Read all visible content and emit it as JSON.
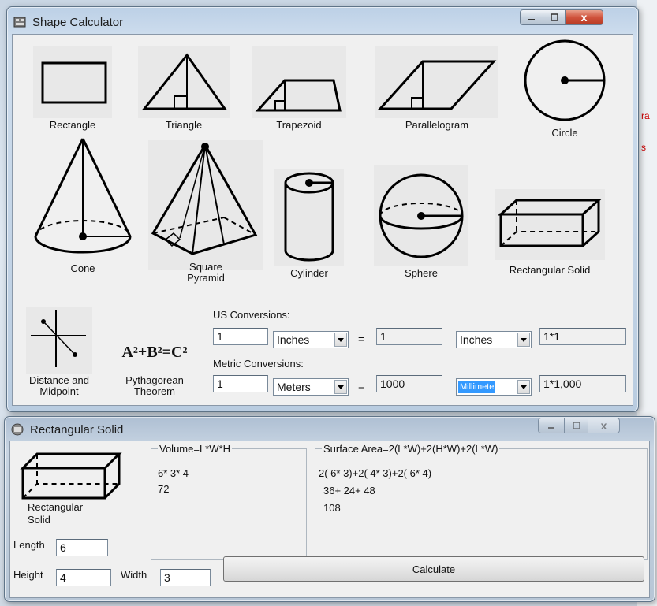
{
  "main_window": {
    "title": "Shape Calculator",
    "close_glyph": "x"
  },
  "shapes": {
    "rectangle": "Rectangle",
    "triangle": "Triangle",
    "trapezoid": "Trapezoid",
    "parallelogram": "Parallelogram",
    "circle": "Circle",
    "cone": "Cone",
    "square_pyramid_line1": "Square",
    "square_pyramid_line2": "Pyramid",
    "cylinder": "Cylinder",
    "sphere": "Sphere",
    "rectangular_solid": "Rectangular Solid",
    "distance_line1": "Distance and",
    "distance_line2": "Midpoint",
    "pythagorean_line1": "Pythagorean",
    "pythagorean_line2": "Theorem",
    "pythagorean_formula": "A²+B²=C²"
  },
  "conversions": {
    "us_label": "US Conversions:",
    "us_input": "1",
    "us_from_unit": "Inches",
    "equals": "=",
    "us_result": "1",
    "us_to_unit": "Inches",
    "us_formula": "1*1",
    "metric_label": "Metric Conversions:",
    "metric_input": "1",
    "metric_from_unit": "Meters",
    "metric_result": "1000",
    "metric_to_unit": "Millimete",
    "metric_formula": "1*1,000"
  },
  "rect_window": {
    "title": "Rectangular Solid",
    "shape_label_line1": "Rectangular",
    "shape_label_line2": "Solid",
    "volume_legend": "Volume=L*W*H",
    "volume_line1": "6* 3* 4",
    "volume_line2": "72",
    "surface_legend": "Surface Area=2(L*W)+2(H*W)+2(L*W)",
    "surface_line1": "2( 6* 3)+2( 4* 3)+2( 6* 4)",
    "surface_line2": "36+ 24+ 48",
    "surface_line3": "108",
    "length_label": "Length",
    "length_value": "6",
    "height_label": "Height",
    "height_value": "4",
    "width_label": "Width",
    "width_value": "3",
    "calculate_label": "Calculate"
  },
  "colors": {
    "selection": "#3399ff",
    "close_button": "#c9452e"
  }
}
